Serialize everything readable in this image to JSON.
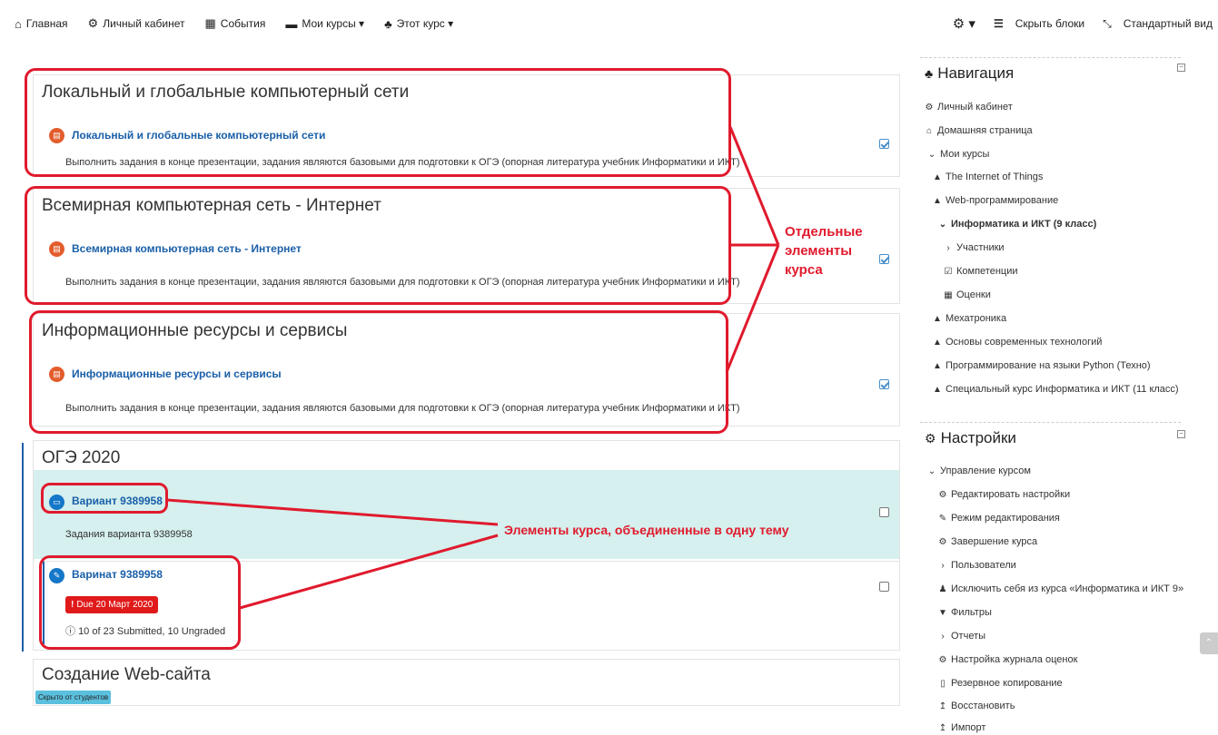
{
  "topbar": {
    "nav": [
      {
        "icon": "home-icon",
        "glyph": "⌂",
        "label": "Главная"
      },
      {
        "icon": "dashboard-icon",
        "glyph": "⚙",
        "label": "Личный кабинет"
      },
      {
        "icon": "calendar-icon",
        "glyph": "▦",
        "label": "События"
      },
      {
        "icon": "briefcase-icon",
        "glyph": "▬",
        "label": "Мои курсы ▾"
      },
      {
        "icon": "sitemap-icon",
        "glyph": "♣",
        "label": "Этот курс ▾"
      }
    ],
    "right": {
      "settings_glyph": "⚙ ▾",
      "hide_blocks": "Скрыть блоки",
      "standard_view": "Стандартный вид"
    }
  },
  "sections": [
    {
      "title": "Локальный и глобальные компьютерный сети",
      "activity": "Локальный и глобальные компьютерный сети",
      "desc": "Выполнить задания в конце презентации, задания являются базовыми для подготовки к ОГЭ (опорная литература учебник Информатики и ИКТ)"
    },
    {
      "title": "Всемирная компьютерная сеть - Интернет",
      "activity": "Всемирная компьютерная сеть - Интернет",
      "desc": "Выполнить задания в конце презентации, задания являются базовыми для подготовки к ОГЭ (опорная литература учебник Информатики и ИКТ)"
    },
    {
      "title": "Информационные ресурсы и сервисы",
      "activity": "Информационные ресурсы и сервисы",
      "desc": "Выполнить задания в конце презентации, задания являются базовыми для подготовки к ОГЭ (опорная литература учебник Информатики и ИКТ)"
    }
  ],
  "oge": {
    "title": "ОГЭ 2020",
    "folder": {
      "label": "Вариант 9389958",
      "desc": "Задания варианта 9389958"
    },
    "assign": {
      "label": "Варинат 9389958",
      "due": "Due 20 Март 2020",
      "status": "10 of 23 Submitted, 10 Ungraded"
    }
  },
  "web": {
    "title": "Создание Web-сайта",
    "hidden": "Скрыто от студентов"
  },
  "annotations": {
    "separate_line1": "Отдельные",
    "separate_line2": "элементы",
    "separate_line3": "курса",
    "grouped": "Элементы курса, объединенные в одну тему"
  },
  "navigation": {
    "title": "Навигация",
    "items": [
      "Личный кабинет",
      "Домашняя страница",
      "Мои курсы",
      "The Internet of Things",
      "Web-программирование",
      "Информатика и ИКТ (9 класс)",
      "Участники",
      "Компетенции",
      "Оценки",
      "Мехатроника",
      "Основы современных технологий",
      "Программирование на языки Python (Техно)",
      "Специальный курс Информатика и ИКТ (11 класс)"
    ]
  },
  "settings": {
    "title": "Настройки",
    "items": [
      "Управление курсом",
      "Редактировать настройки",
      "Режим редактирования",
      "Завершение курса",
      "Пользователи",
      "Исключить себя из курса «Информатика и ИКТ 9»",
      "Фильтры",
      "Отчеты",
      "Настройка журнала оценок",
      "Резервное копирование",
      "Восстановить",
      "Импорт"
    ]
  },
  "colors": {
    "link": "#1a5fa8",
    "annotation": "#e01a2d",
    "highlight": "#d5f0ee",
    "pdf_icon": "#e35d2c",
    "folder_icon": "#1577c8"
  }
}
